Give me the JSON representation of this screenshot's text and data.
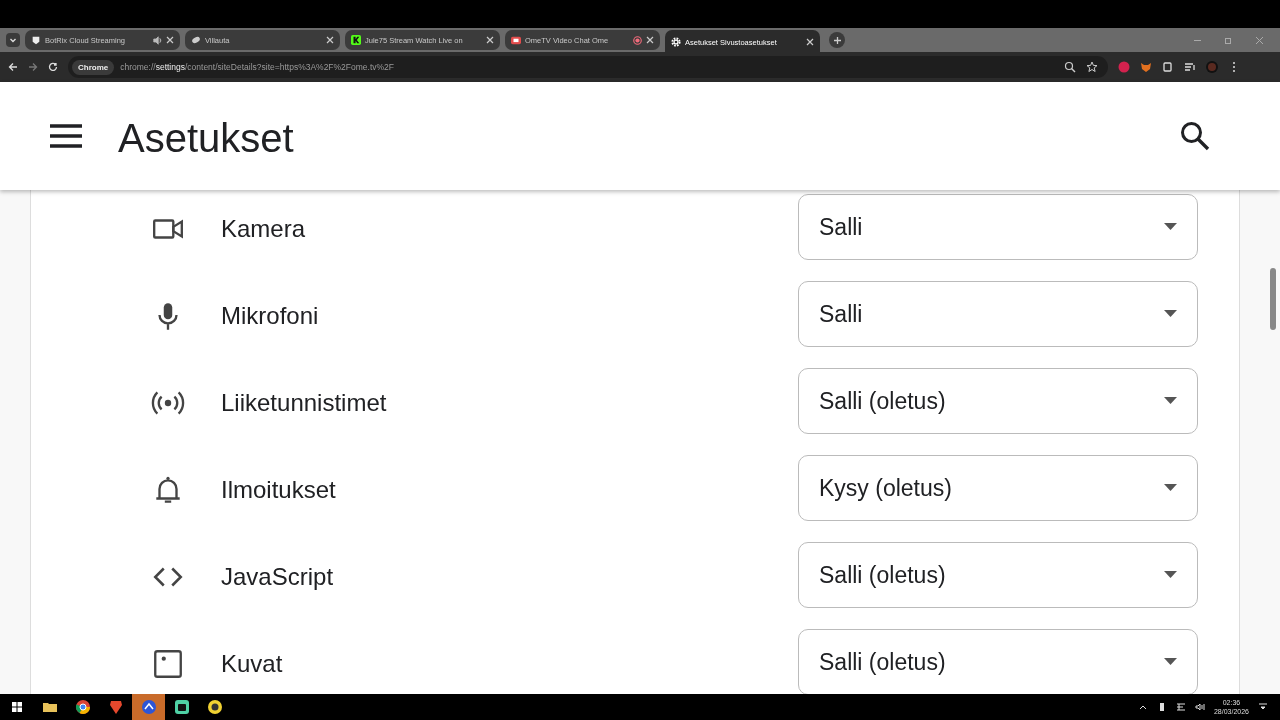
{
  "browser": {
    "tabs": [
      {
        "label": "BotRix  Cloud Streaming",
        "selected": false
      },
      {
        "label": "Villauta",
        "selected": false
      },
      {
        "label": "Jule75 Stream  Watch Live on",
        "selected": false
      },
      {
        "label": "OmeTV Video Chat  Ome",
        "selected": false
      },
      {
        "label": "Asetukset  Sivustoasetukset",
        "selected": true
      }
    ],
    "chip": "Chrome",
    "url": "chrome://**settings**/content/siteDetails?site=https%3A%2F%2Fome.tv%2F"
  },
  "header": {
    "title": "Asetukset"
  },
  "permissions": [
    {
      "kind": "camera",
      "label": "Kamera",
      "value": "Salli"
    },
    {
      "kind": "microphone",
      "label": "Mikrofoni",
      "value": "Salli"
    },
    {
      "kind": "sensors",
      "label": "Liiketunnistimet",
      "value": "Salli (oletus)"
    },
    {
      "kind": "notifications",
      "label": "Ilmoitukset",
      "value": "Kysy (oletus)"
    },
    {
      "kind": "javascript",
      "label": "JavaScript",
      "value": "Salli (oletus)"
    },
    {
      "kind": "images",
      "label": "Kuvat",
      "value": "Salli (oletus)"
    }
  ],
  "taskbar": {
    "time": "02:36",
    "date": "28/03/2026"
  }
}
